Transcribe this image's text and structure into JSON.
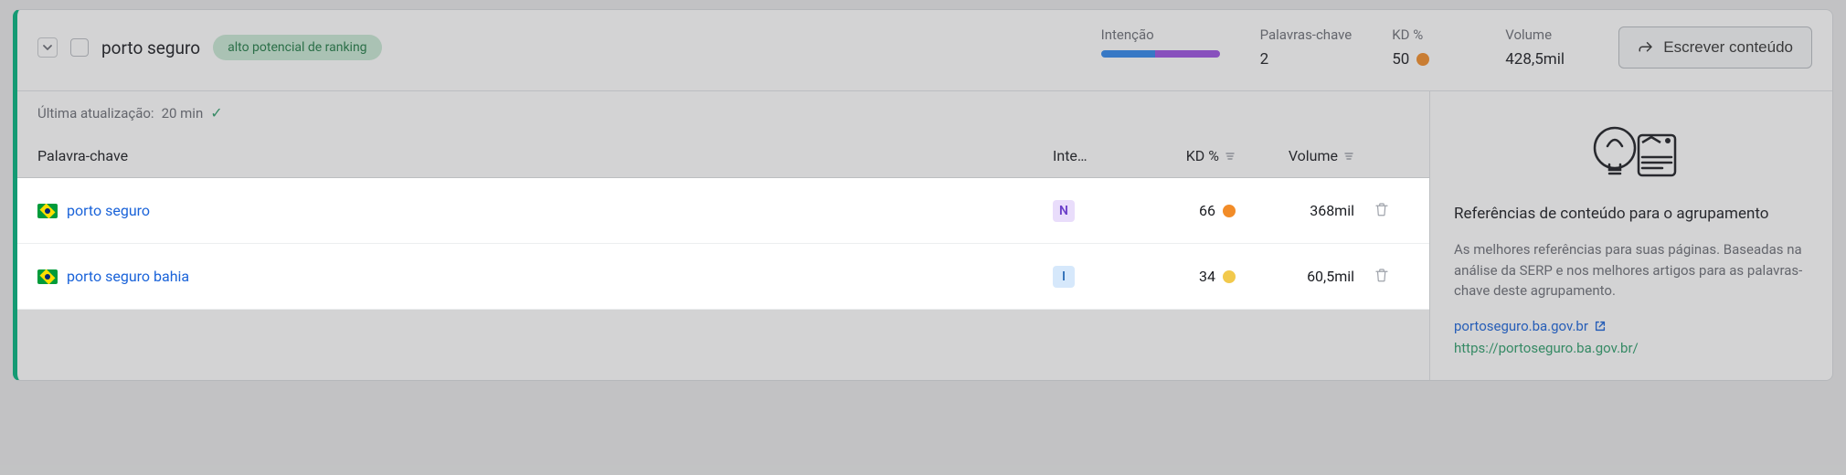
{
  "group": {
    "title": "porto seguro",
    "badge": "alto potencial de ranking",
    "write_button": "Escrever conteúdo"
  },
  "metrics": {
    "intent_label": "Intenção",
    "intent_split": {
      "blue_pct": 46,
      "purple_pct": 54
    },
    "keywords_label": "Palavras-chave",
    "keywords_value": "2",
    "kd_label": "KD %",
    "kd_value": "50",
    "kd_color": "kd-orange",
    "volume_label": "Volume",
    "volume_value": "428,5mil"
  },
  "updated": {
    "prefix": "Última atualização: ",
    "value": "20 min"
  },
  "columns": {
    "keyword": "Palavra-chave",
    "intent": "Inte…",
    "kd": "KD %",
    "volume": "Volume"
  },
  "rows": [
    {
      "keyword": "porto seguro",
      "intent_badge": "N",
      "intent_class": "int-N",
      "kd": "66",
      "kd_color": "kd-orange",
      "volume": "368mil"
    },
    {
      "keyword": "porto seguro bahia",
      "intent_badge": "I",
      "intent_class": "int-I",
      "kd": "34",
      "kd_color": "kd-yellow",
      "volume": "60,5mil"
    }
  ],
  "side": {
    "title": "Referências de conteúdo para o agrupamento",
    "desc": "As melhores referências para suas páginas. Baseadas na análise da SERP e nos melhores artigos para as palavras-chave deste agrupamento.",
    "ref_domain": "portoseguro.ba.gov.br",
    "ref_url": "https://portoseguro.ba.gov.br/"
  }
}
